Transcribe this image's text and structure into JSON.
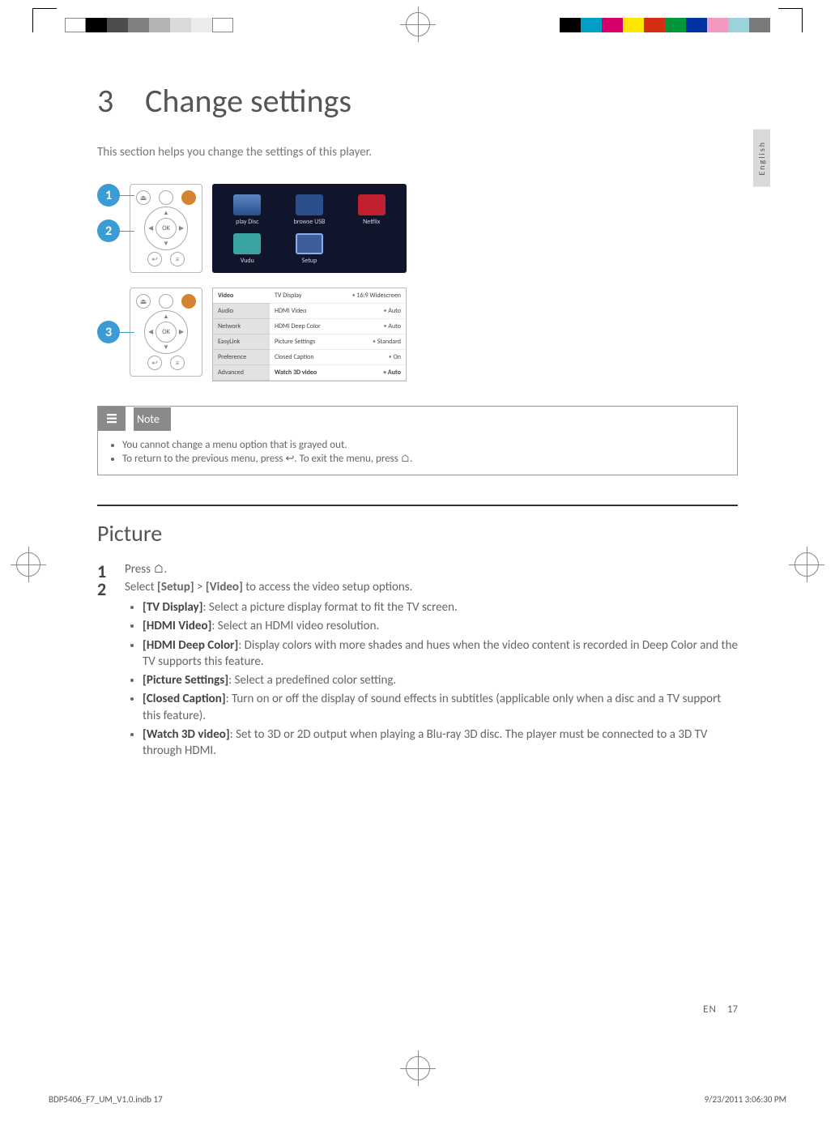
{
  "language_tab": "English",
  "chapter": {
    "number": "3",
    "title": "Change settings"
  },
  "intro": "This section helps you change the settings of this player.",
  "callouts": [
    "1",
    "2",
    "3"
  ],
  "home_menu": {
    "items": [
      {
        "label": "play Disc"
      },
      {
        "label": "browse USB"
      },
      {
        "label": "Netflix"
      },
      {
        "label": "Vudu"
      },
      {
        "label": "Setup"
      }
    ]
  },
  "remote": {
    "ok": "OK"
  },
  "settings_screenshot": {
    "sidebar": [
      "Video",
      "Audio",
      "Network",
      "EasyLink",
      "Preference",
      "Advanced"
    ],
    "rows": [
      {
        "label": "TV Display",
        "value": "16:9 Widescreen"
      },
      {
        "label": "HDMI Video",
        "value": "Auto"
      },
      {
        "label": "HDMI Deep Color",
        "value": "Auto"
      },
      {
        "label": "Picture Settings",
        "value": "Standard"
      },
      {
        "label": "Closed Caption",
        "value": "On"
      },
      {
        "label": "Watch 3D video",
        "value": "Auto"
      }
    ]
  },
  "note": {
    "title": "Note",
    "items": [
      "You cannot change a menu option that is grayed out.",
      "To return to the previous menu, press ↩. To exit the menu, press ⌂."
    ]
  },
  "picture": {
    "heading": "Picture",
    "step1": "Press ⌂.",
    "step2_pre": "Select ",
    "step2_b1": "[Setup]",
    "step2_mid": " > ",
    "step2_b2": "[Video]",
    "step2_post": " to access the video setup options.",
    "options": [
      {
        "name": "[TV Display]",
        "desc": ": Select a picture display format to fit the TV screen."
      },
      {
        "name": "[HDMI Video]",
        "desc": ": Select an HDMI video resolution."
      },
      {
        "name": "[HDMI Deep Color]",
        "desc": ": Display colors with more shades and hues when the video content is recorded in Deep Color and the TV supports this feature."
      },
      {
        "name": "[Picture Settings]",
        "desc": ": Select a predefined color setting."
      },
      {
        "name": "[Closed Caption]",
        "desc": ": Turn on or off the display of sound effects in subtitles (applicable only when a disc and a TV support this feature)."
      },
      {
        "name": "[Watch 3D video]",
        "desc": ": Set to 3D or 2D output when playing a Blu-ray 3D disc. The player must be connected to a 3D TV through HDMI."
      }
    ]
  },
  "page_footer": {
    "lang": "EN",
    "num": "17"
  },
  "imprint": {
    "file": "BDP5406_F7_UM_V1.0.indb   17",
    "date": "9/23/2011   3:06:30 PM"
  },
  "colorbars": {
    "left": [
      "#ffffff",
      "#000000",
      "#4d4d4d",
      "#808080",
      "#b3b3b3",
      "#e6e6e6",
      "#f5f5f5",
      "#ffffff"
    ],
    "right": [
      "#000000",
      "#00a0c6",
      "#d6006c",
      "#ffe600",
      "#d42e12",
      "#009639",
      "#0033a0",
      "#f199c1",
      "#9bd3dd",
      "#7a7a7a"
    ]
  }
}
